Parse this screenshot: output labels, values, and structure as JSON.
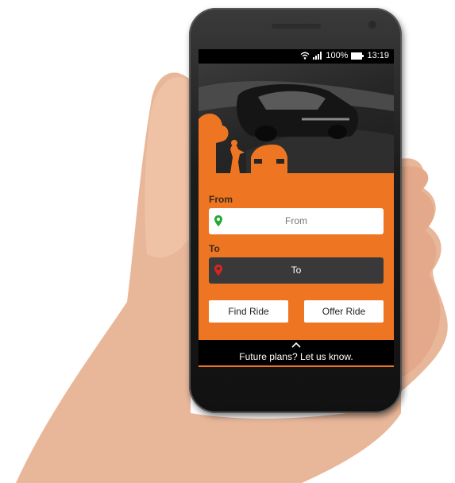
{
  "status_bar": {
    "battery": "100%",
    "time": "13:19"
  },
  "form": {
    "from_label": "From",
    "from_placeholder": "From",
    "to_label": "To",
    "to_placeholder": "To"
  },
  "actions": {
    "find_ride": "Find Ride",
    "offer_ride": "Offer Ride"
  },
  "footer": {
    "message": "Future plans? Let us know."
  },
  "colors": {
    "accent": "#ee7622",
    "from_pin": "#22aa33",
    "to_pin": "#dd2222",
    "to_field_bg": "#393939"
  },
  "icons": [
    "wifi-icon",
    "signal-icon",
    "battery-icon",
    "location-pin-icon",
    "chevron-up-icon"
  ]
}
